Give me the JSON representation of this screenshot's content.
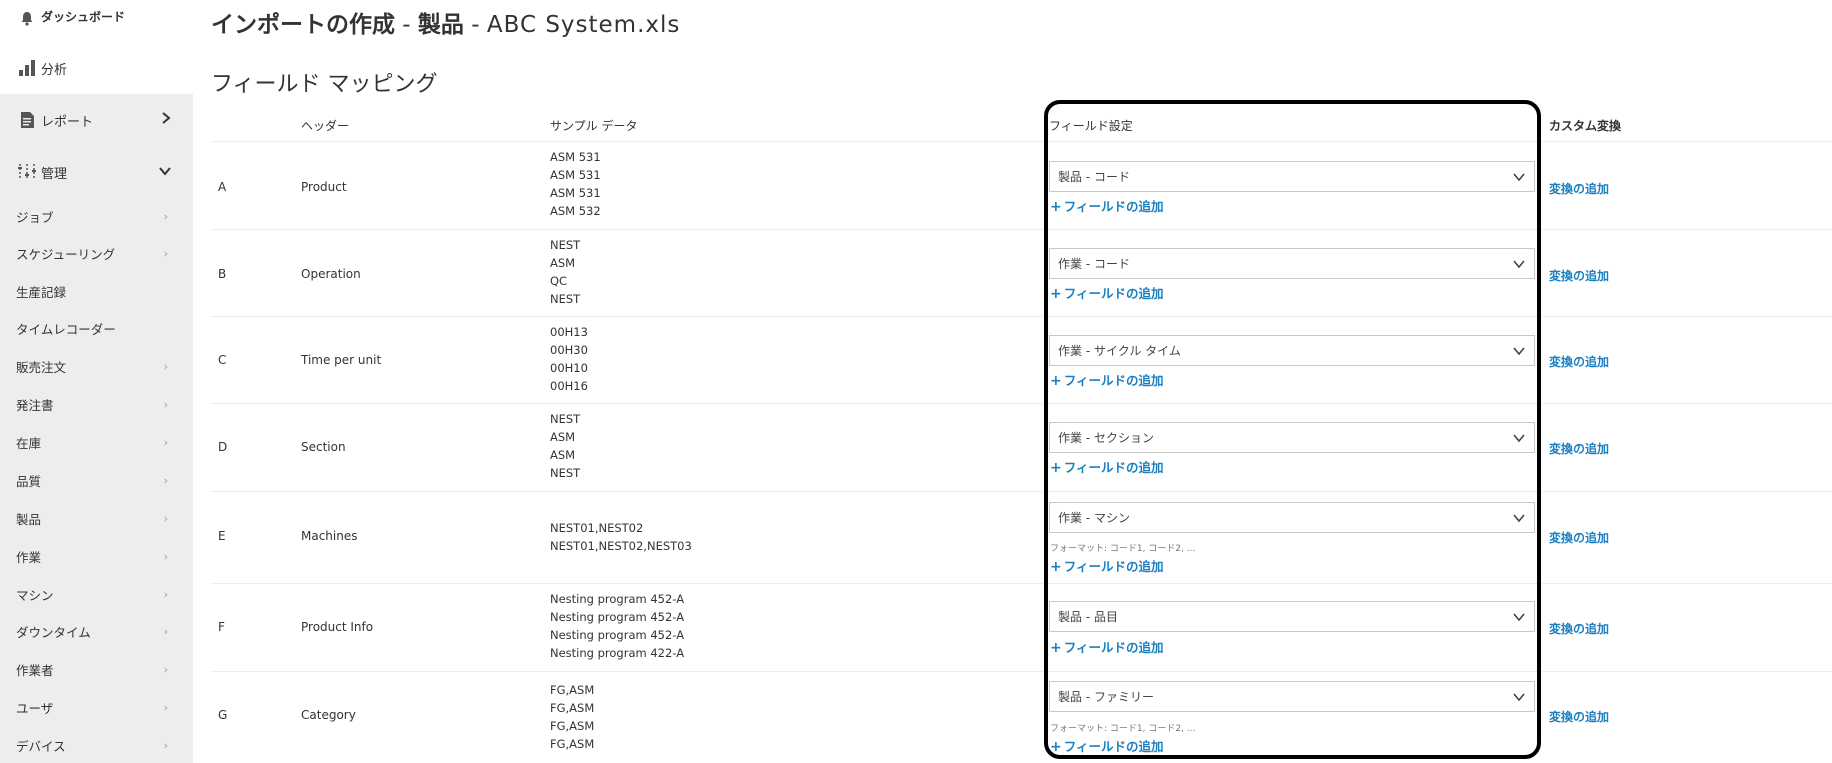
{
  "sidebar": {
    "dashboard": "ダッシュボード",
    "analysis": "分析",
    "reports": "レポート",
    "admin": "管理",
    "items": [
      "ジョブ",
      "スケジューリング",
      "生産記録",
      "タイムレコーダー",
      "販売注文",
      "発注書",
      "在庫",
      "品質",
      "製品",
      "作業",
      "マシン",
      "ダウンタイム",
      "作業者",
      "ユーザ",
      "デバイス"
    ],
    "chevron": "›",
    "icons": [
      "bell-icon",
      "bar-chart-icon",
      "document-icon",
      "sliders-icon"
    ]
  },
  "header": {
    "title_prefix": "インポートの作成",
    "sep1": " - ",
    "title_entity": "製品",
    "sep2": " - ",
    "filename": "ABC System.xls"
  },
  "section_title": "フィールド マッピング",
  "columns": {
    "header": "ヘッダー",
    "sample": "サンプル データ",
    "field_settings": "フィールド設定",
    "custom_transform": "カスタム変換"
  },
  "add_field_label": "フィールドの追加",
  "add_transform_label": "変換の追加",
  "plus_sign": "+",
  "rows": [
    {
      "letter": "A",
      "header": "Product",
      "samples": [
        "ASM 531",
        "ASM 531",
        "ASM 531",
        "ASM 532"
      ],
      "field": "製品 - コード",
      "format_hint": ""
    },
    {
      "letter": "B",
      "header": "Operation",
      "samples": [
        "NEST",
        "ASM",
        "QC",
        "NEST"
      ],
      "field": "作業 - コード",
      "format_hint": ""
    },
    {
      "letter": "C",
      "header": "Time per unit",
      "samples": [
        "00H13",
        "00H30",
        "00H10",
        "00H16"
      ],
      "field": "作業 - サイクル タイム",
      "format_hint": ""
    },
    {
      "letter": "D",
      "header": "Section",
      "samples": [
        "NEST",
        "ASM",
        "ASM",
        "NEST"
      ],
      "field": "作業 - セクション",
      "format_hint": ""
    },
    {
      "letter": "E",
      "header": "Machines",
      "samples": [
        "NEST01,NEST02",
        "NEST01,NEST02,NEST03"
      ],
      "field": "作業 - マシン",
      "format_hint": "フォーマット: コード1, コード2, ..."
    },
    {
      "letter": "F",
      "header": "Product Info",
      "samples": [
        "Nesting program 452-A",
        "Nesting program 452-A",
        "Nesting program 452-A",
        "Nesting program 422-A"
      ],
      "field": "製品 - 品目",
      "format_hint": ""
    },
    {
      "letter": "G",
      "header": "Category",
      "samples": [
        "FG,ASM",
        "FG,ASM",
        "FG,ASM",
        "FG,ASM"
      ],
      "field": "製品 - ファミリー",
      "format_hint": "フォーマット: コード1, コード2, ..."
    }
  ],
  "colors": {
    "sidebar_bg": "#ededed",
    "link": "#1a7fc1",
    "highlight_border": "#000000"
  }
}
